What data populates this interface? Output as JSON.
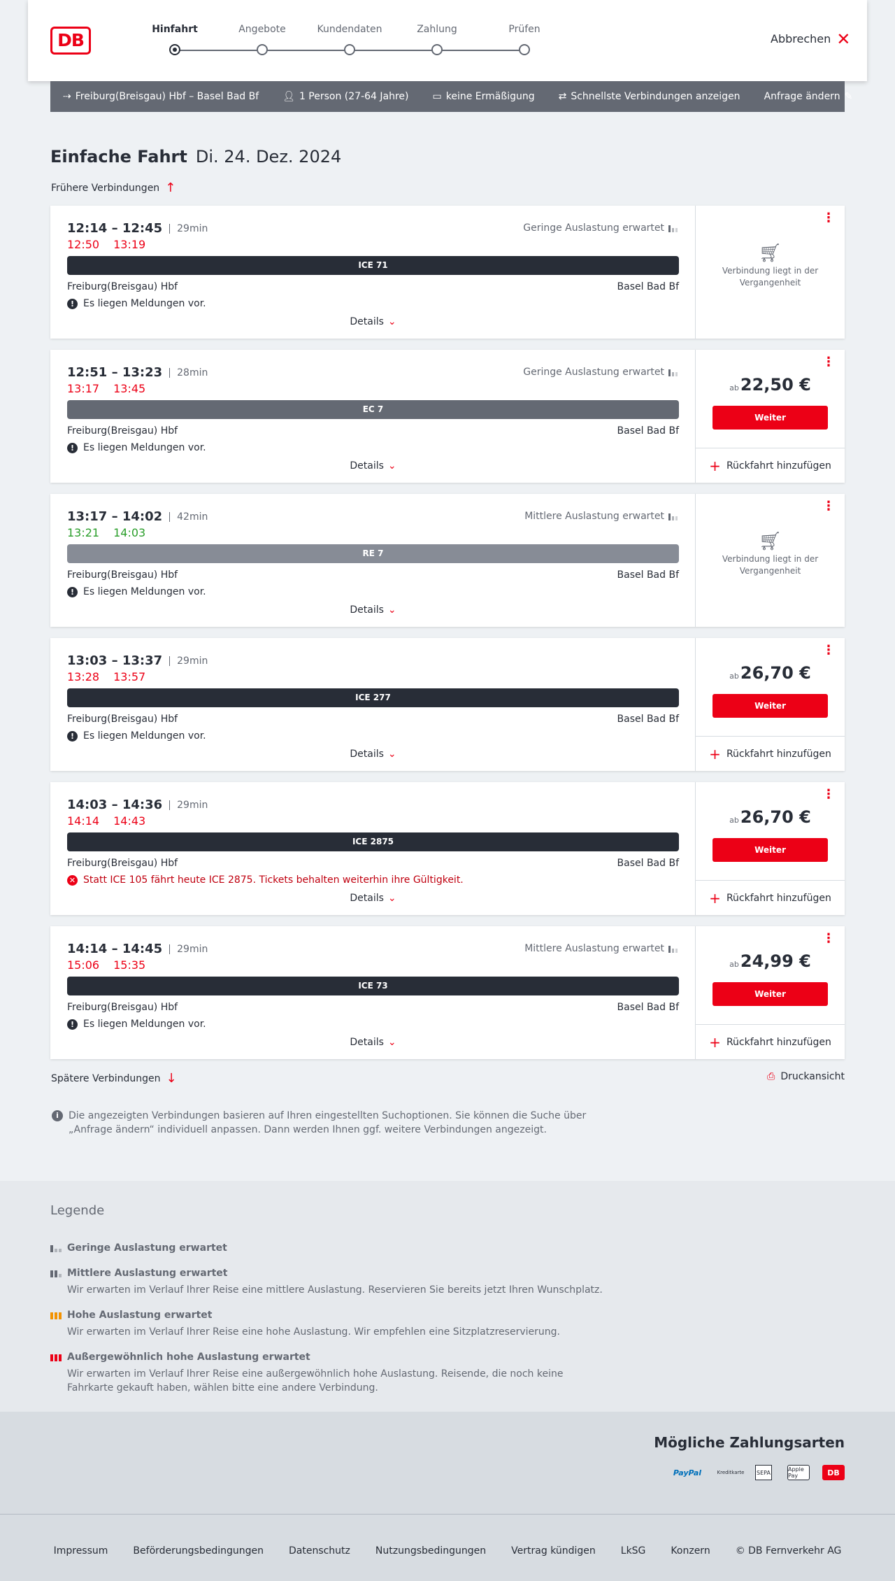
{
  "header": {
    "logo": "DB",
    "steps": [
      {
        "label": "Hinfahrt",
        "active": true
      },
      {
        "label": "Angebote",
        "active": false
      },
      {
        "label": "Kundendaten",
        "active": false
      },
      {
        "label": "Zahlung",
        "active": false
      },
      {
        "label": "Prüfen",
        "active": false
      }
    ],
    "cancel_label": "Abbrechen"
  },
  "search": {
    "route": "Freiburg(Breisgau) Hbf – Basel Bad Bf",
    "passengers": "1 Person (27-64 Jahre)",
    "discount": "keine Ermäßigung",
    "filter": "Schnellste Verbindungen anzeigen",
    "edit_label": "Anfrage ändern"
  },
  "page": {
    "title_bold": "Einfache Fahrt",
    "date": "Di. 24. Dez. 2024",
    "earlier": "Frühere Verbindungen",
    "later": "Spätere Verbindungen",
    "print": "Druckansicht",
    "note": "Die angezeigten Verbindungen basieren auf Ihren eingestellten Suchoptionen. Sie können die Suche über „Anfrage ändern“ individuell anpassen. Dann werden Ihnen ggf. weitere Verbindungen angezeigt."
  },
  "labels": {
    "details": "Details",
    "weiter": "Weiter",
    "rueckfahrt": "Rückfahrt hinzufügen",
    "ab": "ab",
    "past": "Verbindung liegt in der Vergangenheit"
  },
  "connections": [
    {
      "times": "12:14 – 12:45",
      "duration": "29min",
      "rt_dep": "12:50",
      "rt_arr": "13:19",
      "rt_color": "red",
      "load": "Geringe Auslastung erwartet",
      "train": "ICE 71",
      "train_color": "#282d37",
      "from": "Freiburg(Breisgau) Hbf",
      "to": "Basel Bad Bf",
      "message": "Es liegen Meldungen vor.",
      "message_type": "info",
      "price": null
    },
    {
      "times": "12:51 – 13:23",
      "duration": "28min",
      "rt_dep": "13:17",
      "rt_arr": "13:45",
      "rt_color": "red",
      "load": "Geringe Auslastung erwartet",
      "train": "EC 7",
      "train_color": "#646973",
      "from": "Freiburg(Breisgau) Hbf",
      "to": "Basel Bad Bf",
      "message": "Es liegen Meldungen vor.",
      "message_type": "info",
      "price": "22,50 €"
    },
    {
      "times": "13:17 – 14:02",
      "duration": "42min",
      "rt_dep": "13:21",
      "rt_arr": "14:03",
      "rt_color": "green",
      "load": "Mittlere Auslastung erwartet",
      "train": "RE 7",
      "train_color": "#878c96",
      "from": "Freiburg(Breisgau) Hbf",
      "to": "Basel Bad Bf",
      "message": "Es liegen Meldungen vor.",
      "message_type": "info",
      "price": null
    },
    {
      "times": "13:03 – 13:37",
      "duration": "29min",
      "rt_dep": "13:28",
      "rt_arr": "13:57",
      "rt_color": "red",
      "load": "",
      "train": "ICE 277",
      "train_color": "#282d37",
      "from": "Freiburg(Breisgau) Hbf",
      "to": "Basel Bad Bf",
      "message": "Es liegen Meldungen vor.",
      "message_type": "info",
      "price": "26,70 €"
    },
    {
      "times": "14:03 – 14:36",
      "duration": "29min",
      "rt_dep": "14:14",
      "rt_arr": "14:43",
      "rt_color": "red",
      "load": "",
      "train": "ICE 2875",
      "train_color": "#282d37",
      "from": "Freiburg(Breisgau) Hbf",
      "to": "Basel Bad Bf",
      "message": "Statt ICE 105 fährt heute ICE 2875. Tickets behalten weiterhin ihre Gültigkeit.",
      "message_type": "warning",
      "price": "26,70 €"
    },
    {
      "times": "14:14 – 14:45",
      "duration": "29min",
      "rt_dep": "15:06",
      "rt_arr": "15:35",
      "rt_color": "red",
      "load": "Mittlere Auslastung erwartet",
      "train": "ICE 73",
      "train_color": "#282d37",
      "from": "Freiburg(Breisgau) Hbf",
      "to": "Basel Bad Bf",
      "message": "Es liegen Meldungen vor.",
      "message_type": "info",
      "price": "24,99 €"
    }
  ],
  "legend": {
    "title": "Legende",
    "items": [
      {
        "title": "Geringe Auslastung erwartet",
        "desc": "",
        "color": "#646973"
      },
      {
        "title": "Mittlere Auslastung erwartet",
        "desc": "Wir erwarten im Verlauf Ihrer Reise eine mittlere Auslastung. Reservieren Sie bereits jetzt Ihren Wunschplatz.",
        "color": "#646973"
      },
      {
        "title": "Hohe Auslastung erwartet",
        "desc": "Wir erwarten im Verlauf Ihrer Reise eine hohe Auslastung. Wir empfehlen eine Sitzplatzreservierung.",
        "color": "#f39200"
      },
      {
        "title": "Außergewöhnlich hohe Auslastung erwartet",
        "desc": "Wir erwarten im Verlauf Ihrer Reise eine außergewöhnlich hohe Auslastung. Reisende, die noch keine Fahrkarte gekauft haben, wählen bitte eine andere Verbindung.",
        "color": "#ec0016"
      }
    ]
  },
  "payment": {
    "title": "Mögliche Zahlungsarten",
    "methods": [
      "PayPal",
      "Kreditkarte",
      "SEPA",
      "Apple Pay",
      "DB"
    ]
  },
  "footer": {
    "links": [
      "Impressum",
      "Beförderungsbedingungen",
      "Datenschutz",
      "Nutzungsbedingungen",
      "Vertrag kündigen",
      "LkSG",
      "Konzern",
      "© DB Fernverkehr AG"
    ]
  }
}
